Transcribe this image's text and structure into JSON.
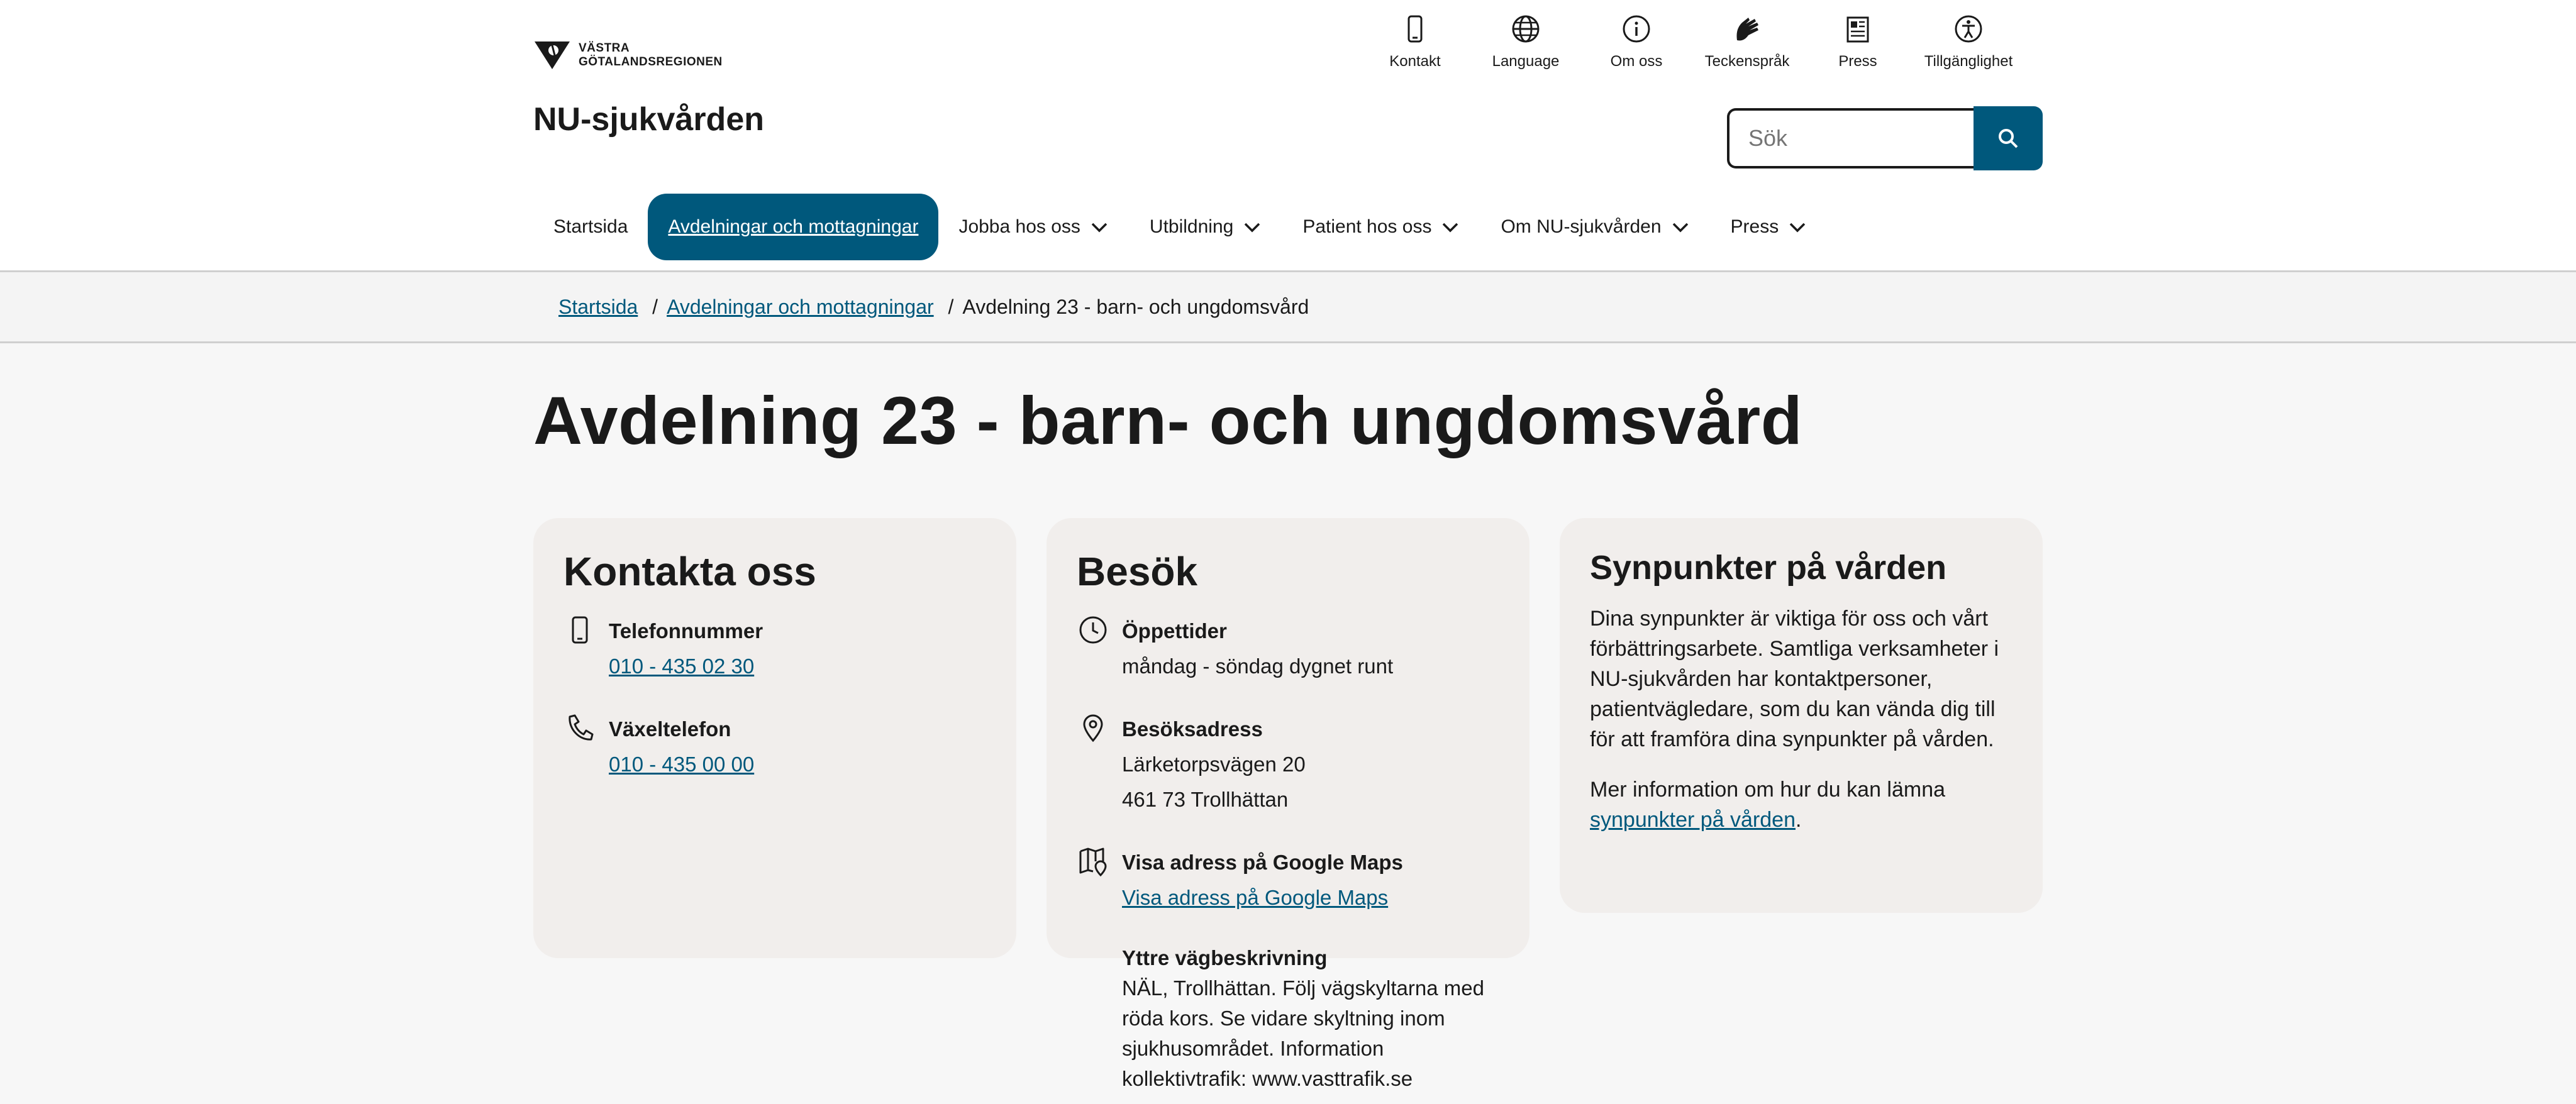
{
  "header": {
    "logo_line1": "VÄSTRA",
    "logo_line2": "GÖTALANDSREGIONEN",
    "site_title": "NU-sjukvården",
    "util_nav": [
      {
        "label": "Kontakt",
        "icon": "phone-icon"
      },
      {
        "label": "Language",
        "icon": "globe-icon"
      },
      {
        "label": "Om oss",
        "icon": "info-icon"
      },
      {
        "label": "Teckenspråk",
        "icon": "sign-language-icon"
      },
      {
        "label": "Press",
        "icon": "newspaper-icon"
      },
      {
        "label": "Tillgänglighet",
        "icon": "accessibility-icon"
      }
    ],
    "search_placeholder": "Sök"
  },
  "main_nav": [
    {
      "label": "Startsida",
      "has_dropdown": false
    },
    {
      "label": "Avdelningar och mottagningar",
      "has_dropdown": false,
      "active": true
    },
    {
      "label": "Jobba hos oss",
      "has_dropdown": true
    },
    {
      "label": "Utbildning",
      "has_dropdown": true
    },
    {
      "label": "Patient hos oss",
      "has_dropdown": true
    },
    {
      "label": "Om NU-sjukvården",
      "has_dropdown": true
    },
    {
      "label": "Press",
      "has_dropdown": true
    }
  ],
  "breadcrumb": {
    "items": [
      "Startsida",
      "Avdelningar och mottagningar"
    ],
    "current": "Avdelning 23 - barn- och ungdomsvård"
  },
  "page_title": "Avdelning 23 - barn- och ungdomsvård",
  "kontakta": {
    "title": "Kontakta oss",
    "rows": [
      {
        "label": "Telefonnummer",
        "value": "010 - 435 02 30",
        "icon": "mobile-phone-icon"
      },
      {
        "label": "Växeltelefon",
        "value": "010 - 435 00 00",
        "icon": "phone-handset-icon"
      }
    ]
  },
  "besok": {
    "title": "Besök",
    "opening_label": "Öppettider",
    "opening_value": "måndag - söndag dygnet runt",
    "address_label": "Besöksadress",
    "address_line1": "Lärketorpsvägen 20",
    "address_line2": "461 73 Trollhättan",
    "maps_label": "Visa adress på Google Maps",
    "maps_link": "Visa adress på Google Maps",
    "route_label": "Yttre vägbeskrivning",
    "route_text": "NÄL, Trollhättan. Följ vägskyltarna med röda kors. Se vidare skyltning inom sjukhusområdet. Information kollektivtrafik: www.vasttrafik.se"
  },
  "synpunkter": {
    "title": "Synpunkter på vården",
    "para1": "Dina synpunkter är viktiga för oss och vårt förbättringsarbete. Samtliga verksamheter i NU-sjukvården har kontaktpersoner, patientvägledare, som du kan vända dig till för att framföra dina synpunkter på vården.",
    "para2_prefix": "Mer information om hur du kan lämna",
    "para2_link": "synpunkter på vården",
    "para2_suffix": "."
  },
  "colors": {
    "accent": "#00587c",
    "card_bg": "#f1eeec"
  }
}
